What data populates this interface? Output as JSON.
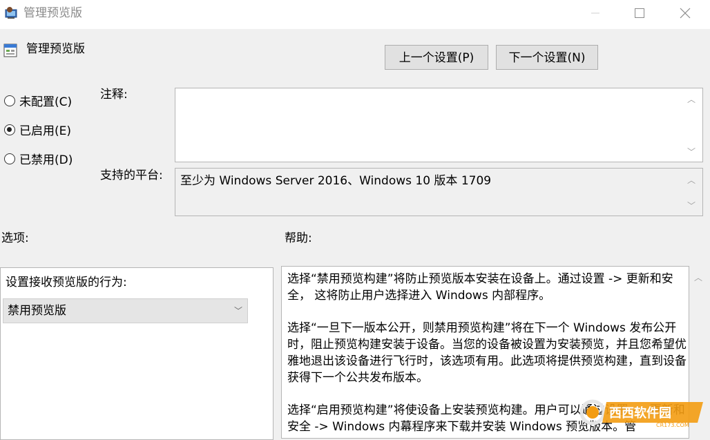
{
  "window": {
    "title": "管理预览版"
  },
  "header": {
    "policy_title": "管理预览版",
    "prev_label": "上一个设置(P)",
    "next_label": "下一个设置(N)"
  },
  "state": {
    "not_configured": "未配置(C)",
    "enabled": "已启用(E)",
    "disabled": "已禁用(D)",
    "selected": "enabled"
  },
  "comment": {
    "label": "注释:",
    "value": ""
  },
  "platforms": {
    "label": "支持的平台:",
    "value": "至少为 Windows Server 2016、Windows 10 版本 1709"
  },
  "options": {
    "label": "选项:",
    "field_label": "设置接收预览版的行为:",
    "selected_value": "禁用预览版"
  },
  "help": {
    "label": "帮助:",
    "paragraphs": [
      "选择“禁用预览构建”将防止预览版本安装在设备上。通过设置 -> 更新和安全， 这将防止用户选择进入 Windows 内部程序。",
      "选择“一旦下一版本公开，则禁用预览构建”将在下一个 Windows 发布公开时，阻止预览构建安装于设备。当您的设备被设置为安装预览，并且您希望优雅地退出该设备进行飞行时，该选项有用。此选项将提供预览构建，直到设备获得下一个公共发布版本。",
      "选择“启用预览构建”将使设备上安装预览构建。用户可以通过设置 -> 更新和安全 -> Windows 内幕程序来下载并安装 Windows 预览版本。管"
    ]
  },
  "watermark": {
    "brand": "西西软件园",
    "domain": "CR173.COM"
  },
  "icons": {
    "app": "group-policy-icon",
    "policy": "policy-setting-icon",
    "minimize": "minimize-icon",
    "maximize": "maximize-icon",
    "close": "close-icon"
  },
  "colors": {
    "window_bg": "#f0f0f0",
    "titlebar_bg": "#ffffff",
    "button_bg": "#e1e1e1",
    "border": "#b5b5b5",
    "watermark_orange": "#f39c12"
  }
}
